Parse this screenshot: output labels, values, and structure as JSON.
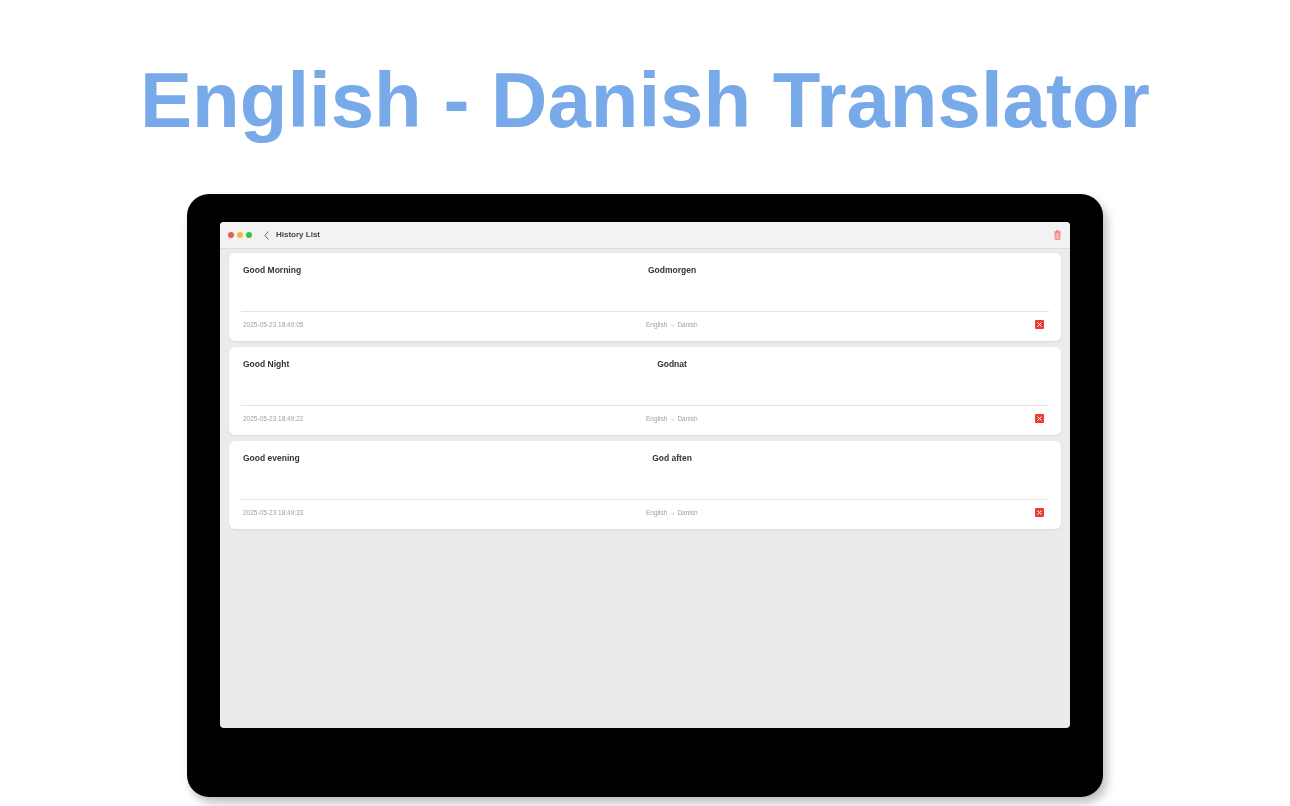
{
  "page": {
    "title": "English - Danish Translator"
  },
  "window": {
    "title": "History List"
  },
  "history": [
    {
      "source": "Good Morning",
      "translation": "Godmorgen",
      "timestamp": "2025-05-23 18:49:05",
      "languages": "English → Danish"
    },
    {
      "source": "Good Night",
      "translation": "Godnat",
      "timestamp": "2025-05-23 18:49:22",
      "languages": "English → Danish"
    },
    {
      "source": "Good evening",
      "translation": "God aften",
      "timestamp": "2025-05-23 18:49:33",
      "languages": "English → Danish"
    }
  ]
}
